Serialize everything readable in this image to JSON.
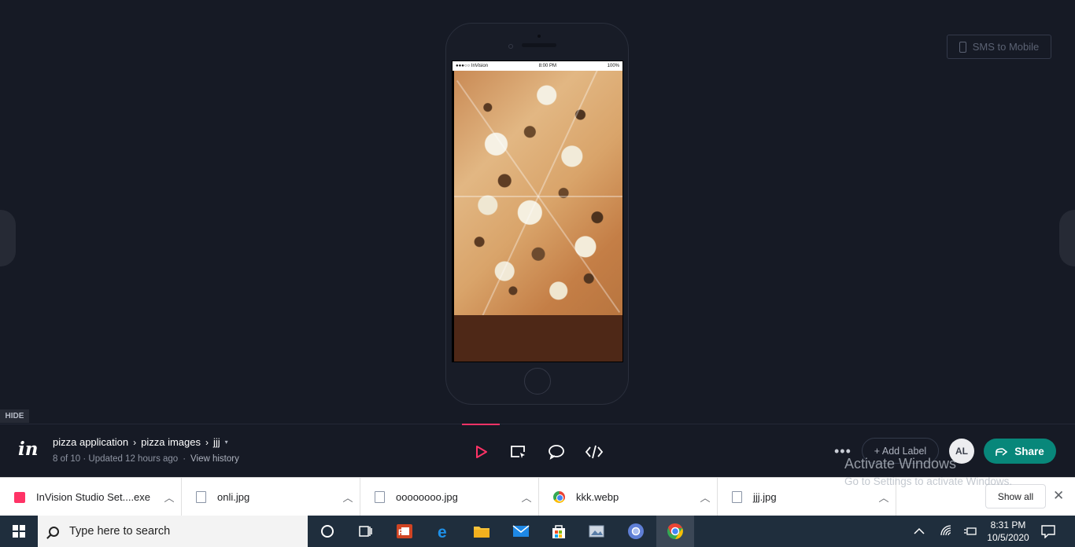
{
  "phone": {
    "statusbar": {
      "carrier": "●●●○○ InVision",
      "time": "8:00 PM",
      "battery": "100%"
    }
  },
  "sms_button": {
    "label": "SMS to Mobile"
  },
  "hide_tab": {
    "label": "HIDE"
  },
  "project": {
    "breadcrumb": [
      "pizza application",
      "pizza images",
      "jjj"
    ],
    "meta": "8 of 10 · Updated 12 hours ago",
    "history_link": "View history"
  },
  "toolbar": {
    "add_label": "+ Add Label",
    "avatar_initials": "AL",
    "share_label": "Share"
  },
  "watermark": {
    "title": "Activate Windows",
    "subtitle": "Go to Settings to activate Windows."
  },
  "downloads": {
    "items": [
      {
        "name": "InVision Studio Set....exe",
        "icon": "invision-exe-icon"
      },
      {
        "name": "onli.jpg",
        "icon": "file-icon"
      },
      {
        "name": "oooooooo.jpg",
        "icon": "file-icon"
      },
      {
        "name": "kkk.webp",
        "icon": "chrome-icon"
      },
      {
        "name": "jjj.jpg",
        "icon": "file-icon"
      }
    ],
    "show_all": "Show all"
  },
  "taskbar": {
    "search_placeholder": "Type here to search",
    "clock_time": "8:31 PM",
    "clock_date": "10/5/2020"
  },
  "colors": {
    "accent_pink": "#ff3366",
    "share_teal": "#08877a",
    "stage_bg": "#161a25"
  }
}
